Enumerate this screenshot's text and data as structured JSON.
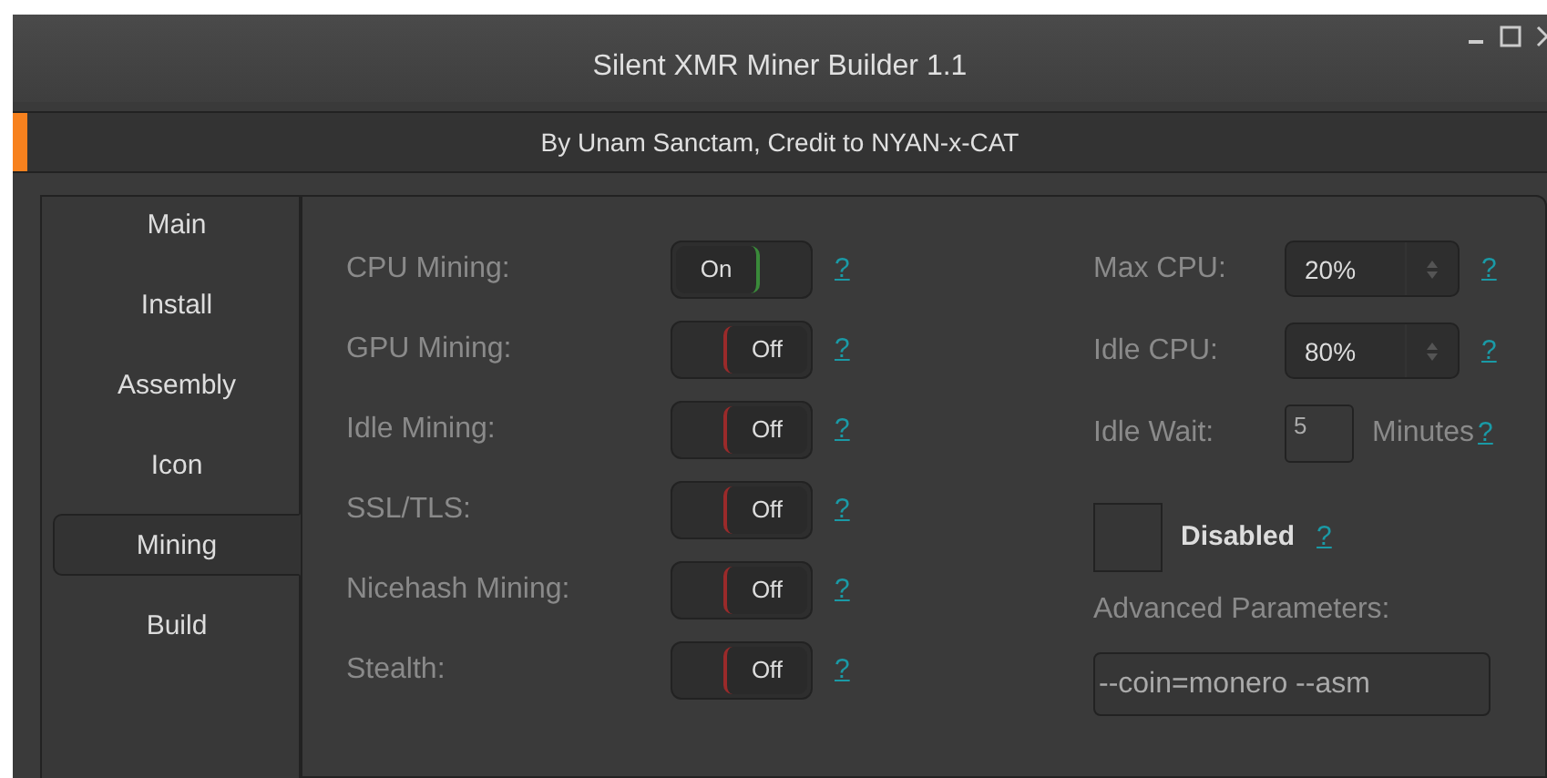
{
  "window": {
    "title": "Silent XMR Miner Builder 1.1"
  },
  "credit_bar": {
    "text": "By Unam Sanctam, Credit to NYAN-x-CAT"
  },
  "tabs": [
    {
      "label": "Main",
      "selected": false
    },
    {
      "label": "Install",
      "selected": false
    },
    {
      "label": "Assembly",
      "selected": false
    },
    {
      "label": "Icon",
      "selected": false
    },
    {
      "label": "Mining",
      "selected": true
    },
    {
      "label": "Build",
      "selected": false
    }
  ],
  "toggles": [
    {
      "label": "CPU Mining:",
      "state": "On",
      "on": true,
      "help": "?"
    },
    {
      "label": "GPU Mining:",
      "state": "Off",
      "on": false,
      "help": "?"
    },
    {
      "label": "Idle Mining:",
      "state": "Off",
      "on": false,
      "help": "?"
    },
    {
      "label": "SSL/TLS:",
      "state": "Off",
      "on": false,
      "help": "?"
    },
    {
      "label": "Nicehash Mining:",
      "state": "Off",
      "on": false,
      "help": "?"
    },
    {
      "label": "Stealth:",
      "state": "Off",
      "on": false,
      "help": "?"
    }
  ],
  "spinners": [
    {
      "label": "Max CPU:",
      "value": "20%",
      "help": "?"
    },
    {
      "label": "Idle CPU:",
      "value": "80%",
      "help": "?"
    }
  ],
  "idle_wait": {
    "label": "Idle Wait:",
    "value": "5",
    "unit": "Minutes",
    "help": "?"
  },
  "disabled_checkbox": {
    "label": "Disabled",
    "checked": false,
    "help": "?"
  },
  "advanced": {
    "label": "Advanced Parameters:",
    "value": "--coin=monero --asm"
  }
}
